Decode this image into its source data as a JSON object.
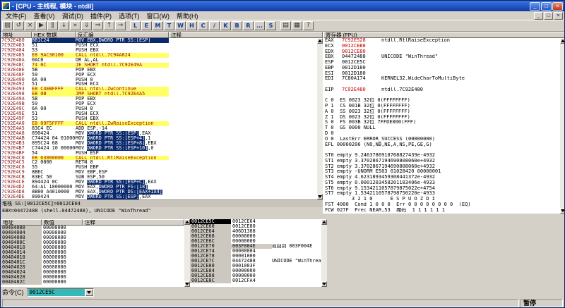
{
  "colors": {
    "title_blue": "#1b4fc4",
    "selection_navy": "#0b2a6e",
    "highlight_yellow": "#ffff66",
    "changed_register_red": "#c40000",
    "address_red": "#8a1616",
    "command_selection_teal": "#35b8b8"
  },
  "titlebar": {
    "title": "- [CPU - 主线程, 模块 - ntdll]"
  },
  "menu": {
    "items": [
      "文件(F)",
      "查看(V)",
      "调试(D)",
      "插件(P)",
      "选项(T)",
      "窗口(W)",
      "帮助(H)"
    ]
  },
  "toolbar": {
    "icon_buttons": [
      {
        "name": "open",
        "glyph": "▨"
      },
      {
        "name": "restart",
        "glyph": "↺"
      },
      {
        "name": "close-process",
        "glyph": "×"
      },
      {
        "name": "run",
        "glyph": "▶"
      },
      {
        "name": "pause",
        "glyph": "‖"
      },
      {
        "name": "step-into",
        "glyph": "↓"
      },
      {
        "name": "step-over",
        "glyph": "»"
      },
      {
        "name": "trace-into",
        "glyph": "⇓"
      },
      {
        "name": "trace-over",
        "glyph": "⇒"
      },
      {
        "name": "till-return",
        "glyph": "↑"
      },
      {
        "name": "goto",
        "glyph": "→"
      }
    ],
    "letter_buttons": [
      "L",
      "E",
      "M",
      "T",
      "W",
      "H",
      "C",
      "/",
      "K",
      "B",
      "R",
      "...",
      "S"
    ],
    "extra_buttons": [
      {
        "name": "appearance",
        "glyph": "▤"
      },
      {
        "name": "options",
        "glyph": "▦"
      },
      {
        "name": "help",
        "glyph": "?"
      }
    ]
  },
  "disasm": {
    "headers": [
      "地址",
      "HEX 数据",
      "反汇编",
      "注释"
    ],
    "rows": [
      {
        "addr": "7C92E480",
        "hex": "8B1C24",
        "segs": [
          [
            "MOV EBX,DWORD PTR SS:[ESP]",
            "p"
          ]
        ],
        "comment": "",
        "style": "sel"
      },
      {
        "addr": "7C92E483",
        "hex": "51",
        "segs": [
          [
            "PUSH ECX",
            "p"
          ]
        ],
        "comment": ""
      },
      {
        "addr": "7C92E484",
        "hex": "53",
        "segs": [
          [
            "PUSH EBX",
            "p"
          ]
        ],
        "comment": ""
      },
      {
        "addr": "7C92E485",
        "hex": "E8 9AC30100",
        "segs": [
          [
            "CALL ntdll.7C94A824",
            "p"
          ]
        ],
        "comment": "",
        "style": "flow"
      },
      {
        "addr": "7C92E48A",
        "hex": "0AC0",
        "segs": [
          [
            "OR AL,AL",
            "p"
          ]
        ],
        "comment": ""
      },
      {
        "addr": "7C92E48C",
        "hex": "74 0C",
        "segs": [
          [
            "JE SHORT ntdll.7C92E49A",
            "p"
          ]
        ],
        "comment": "",
        "style": "flow"
      },
      {
        "addr": "7C92E48E",
        "hex": "5B",
        "segs": [
          [
            "POP EBX",
            "p"
          ]
        ],
        "comment": ""
      },
      {
        "addr": "7C92E48F",
        "hex": "59",
        "segs": [
          [
            "POP ECX",
            "p"
          ]
        ],
        "comment": ""
      },
      {
        "addr": "7C92E490",
        "hex": "6A 00",
        "segs": [
          [
            "PUSH 0",
            "p"
          ]
        ],
        "comment": ""
      },
      {
        "addr": "7C92E492",
        "hex": "51",
        "segs": [
          [
            "PUSH ECX",
            "p"
          ]
        ],
        "comment": ""
      },
      {
        "addr": "7C92E493",
        "hex": "E8 C4EBFFFF",
        "segs": [
          [
            "CALL ntdll.ZwContinue",
            "p"
          ]
        ],
        "comment": "",
        "style": "flow"
      },
      {
        "addr": "7C92E498",
        "hex": "EB 0B",
        "segs": [
          [
            "JMP SHORT ntdll.7C92E4A5",
            "p"
          ]
        ],
        "comment": "",
        "style": "flow"
      },
      {
        "addr": "7C92E49A",
        "hex": "5B",
        "segs": [
          [
            "POP EBX",
            "p"
          ]
        ],
        "comment": ""
      },
      {
        "addr": "7C92E49B",
        "hex": "59",
        "segs": [
          [
            "POP ECX",
            "p"
          ]
        ],
        "comment": ""
      },
      {
        "addr": "7C92E49C",
        "hex": "6A 00",
        "segs": [
          [
            "PUSH 0",
            "p"
          ]
        ],
        "comment": ""
      },
      {
        "addr": "7C92E49E",
        "hex": "51",
        "segs": [
          [
            "PUSH ECX",
            "p"
          ]
        ],
        "comment": ""
      },
      {
        "addr": "7C92E49F",
        "hex": "53",
        "segs": [
          [
            "PUSH EBX",
            "p"
          ]
        ],
        "comment": ""
      },
      {
        "addr": "7C92E4A0",
        "hex": "E8 09F5FFFF",
        "segs": [
          [
            "CALL ntdll.ZwRaiseException",
            "p"
          ]
        ],
        "comment": "",
        "style": "flow"
      },
      {
        "addr": "7C92E4A5",
        "hex": "83C4 EC",
        "segs": [
          [
            "ADD ESP,-14",
            "p"
          ]
        ],
        "comment": ""
      },
      {
        "addr": "7C92E4A8",
        "hex": "890424",
        "segs": [
          [
            "MOV ",
            "p"
          ],
          [
            "DWORD PTR SS:[ESP]",
            "m"
          ],
          [
            ",EAX",
            "p"
          ]
        ],
        "comment": ""
      },
      {
        "addr": "7C92E4AB",
        "hex": "C74424 04 01000000",
        "segs": [
          [
            "MOV ",
            "p"
          ],
          [
            "DWORD PTR SS:[ESP+4]",
            "m"
          ],
          [
            ",1",
            "p"
          ]
        ],
        "comment": ""
      },
      {
        "addr": "7C92E4B3",
        "hex": "895C24 08",
        "segs": [
          [
            "MOV ",
            "p"
          ],
          [
            "DWORD PTR SS:[ESP+8]",
            "m"
          ],
          [
            ",EBX",
            "p"
          ]
        ],
        "comment": ""
      },
      {
        "addr": "7C92E4B7",
        "hex": "C74424 10 00000000",
        "segs": [
          [
            "MOV ",
            "p"
          ],
          [
            "DWORD PTR SS:[ESP+10]",
            "m"
          ],
          [
            ",0",
            "p"
          ]
        ],
        "comment": ""
      },
      {
        "addr": "7C92E4BF",
        "hex": "54",
        "segs": [
          [
            "PUSH ESP",
            "p"
          ]
        ],
        "comment": ""
      },
      {
        "addr": "7C92E4C0",
        "hex": "E8 63000000",
        "segs": [
          [
            "CALL ntdll.RtlRaiseException",
            "p"
          ]
        ],
        "comment": "",
        "style": "flow"
      },
      {
        "addr": "7C92E4C5",
        "hex": "C2 0800",
        "segs": [
          [
            "RETN 8",
            "p"
          ]
        ],
        "comment": ""
      },
      {
        "addr": "7C92E4C8",
        "hex": "55",
        "segs": [
          [
            "PUSH EBP",
            "p"
          ]
        ],
        "comment": ""
      },
      {
        "addr": "7C92E4C9",
        "hex": "8BEC",
        "segs": [
          [
            "MOV EBP,ESP",
            "p"
          ]
        ],
        "comment": ""
      },
      {
        "addr": "7C92E4CB",
        "hex": "83EC 50",
        "segs": [
          [
            "SUB ESP,50",
            "p"
          ]
        ],
        "comment": ""
      },
      {
        "addr": "7C92E4CE",
        "hex": "894424 0C",
        "segs": [
          [
            "MOV ",
            "p"
          ],
          [
            "DWORD PTR SS:[ESP+C]",
            "m"
          ],
          [
            ",EAX",
            "p"
          ]
        ],
        "comment": ""
      },
      {
        "addr": "7C92E4D2",
        "hex": "64:A1 18000000",
        "segs": [
          [
            "MOV EAX,",
            "p"
          ],
          [
            "DWORD PTR FS:[18]",
            "m"
          ]
        ],
        "comment": ""
      },
      {
        "addr": "7C92E4D8",
        "hex": "8B80 A4010000",
        "segs": [
          [
            "MOV EAX,",
            "p"
          ],
          [
            "DWORD PTR DS:[EAX+1A4]",
            "m"
          ]
        ],
        "comment": ""
      },
      {
        "addr": "7C92E4DE",
        "hex": "890424",
        "segs": [
          [
            "MOV ",
            "p"
          ],
          [
            "DWORD PTR SS:[ESP]",
            "m"
          ],
          [
            ",EAX",
            "p"
          ]
        ],
        "comment": ""
      }
    ]
  },
  "info_pane": {
    "lines": [
      "堆栈 SS:[0012CE5C]=0012CE64",
      "EBX=04472488 (shell.04472488), UNICODE \"WinThread\""
    ]
  },
  "registers": {
    "header": "寄存器 (FPU)",
    "gpr": [
      {
        "name": "EAX",
        "value": "7C92E528",
        "note": "ntdll.RtlRaiseException",
        "changed": true
      },
      {
        "name": "ECX",
        "value": "0012CEB8",
        "note": "",
        "changed": true
      },
      {
        "name": "EDX",
        "value": "0012CE80",
        "note": "",
        "changed": true
      },
      {
        "name": "EBX",
        "value": "04472488",
        "note": "UNICODE \"WinThread\"",
        "changed": false
      },
      {
        "name": "ESP",
        "value": "0012CE5C",
        "note": "",
        "changed": false
      },
      {
        "name": "EBP",
        "value": "0012D180",
        "note": "",
        "changed": false
      },
      {
        "name": "ESI",
        "value": "0012D180",
        "note": "",
        "changed": false
      },
      {
        "name": "EDI",
        "value": "7C80A174",
        "note": "KERNEL32.WideCharToMultiByte",
        "changed": false
      }
    ],
    "eip": {
      "name": "EIP",
      "value": "7C92E480",
      "note": "ntdll.7C92E480",
      "changed": true
    },
    "flag_lines": [
      "C 0  ES 0023 32位 0(FFFFFFFF)",
      "P 1  CS 001B 32位 0(FFFFFFFF)",
      "A 0  SS 0023 32位 0(FFFFFFFF)",
      "Z 1  DS 0023 32位 0(FFFFFFFF)",
      "S 0  FS 003B 32位 7FFDE000(FFF)",
      "T 0  GS 0000 NULL",
      "D 0",
      "O 0  LastErr ERROR_SUCCESS (00000000)"
    ],
    "efl_line": "EFL 00000206 (NO,NB,NE,A,NS,PE,GE,G)",
    "fpu_lines": [
      "ST0 empty 9.2463786918768827439e-4932",
      "ST1 empty 3.3702867194690808060e+4932",
      "ST2 empty 3.3702867194690808060e+4932",
      "ST3 empty -UNORM E503 01028420 00000001",
      "ST4 empty 4.6231893459308441372e-4932",
      "ST5 empty 0.0001203458201183406e-4933",
      "ST6 empty 9.1534211057879875022e+4754",
      "ST7 empty 1.5342110578798750220e-4933"
    ],
    "fpu_status_lines": [
      "         3 2 1 0      E S P U O Z D I",
      "FST 4000  Cond 1 0 0 0  Err 0 0 0 0 0 0 0 0  (EQ)",
      "FCW 027F  Prec NEAR,53  掩码  1 1 1 1 1 1"
    ]
  },
  "dump": {
    "headers": [
      "地址",
      "数值",
      "注释"
    ],
    "rows": [
      [
        "00404000",
        "00000000",
        ""
      ],
      [
        "00404004",
        "00000000",
        ""
      ],
      [
        "00404008",
        "00000000",
        ""
      ],
      [
        "0040400C",
        "00000000",
        ""
      ],
      [
        "00404010",
        "00000000",
        ""
      ],
      [
        "00404014",
        "00000000",
        ""
      ],
      [
        "00404018",
        "00000000",
        ""
      ],
      [
        "0040401C",
        "00000000",
        ""
      ],
      [
        "00404020",
        "00000000",
        ""
      ],
      [
        "00404024",
        "00000000",
        ""
      ],
      [
        "00404028",
        "00000000",
        ""
      ],
      [
        "0040402C",
        "00000000",
        ""
      ]
    ]
  },
  "stack": {
    "rows": [
      {
        "addr": "0012CE5C",
        "value": "0012CE64",
        "comment": "",
        "sel": true
      },
      {
        "addr": "0012CE60",
        "value": "0012CE80",
        "comment": ""
      },
      {
        "addr": "0012CE64",
        "value": "406D1388",
        "comment": ""
      },
      {
        "addr": "0012CE68",
        "value": "00000000",
        "comment": ""
      },
      {
        "addr": "0012CE6C",
        "value": "00000000",
        "comment": ""
      },
      {
        "addr": "0012CE70",
        "value": "003F004E",
        "comment": "返回到 003F004E",
        "code": true
      },
      {
        "addr": "0012CE74",
        "value": "00000004",
        "comment": ""
      },
      {
        "addr": "0012CE78",
        "value": "00001000",
        "comment": ""
      },
      {
        "addr": "0012CE7C",
        "value": "04472488",
        "comment": "UNICODE \"WinThread\""
      },
      {
        "addr": "0012CE80",
        "value": "0001003F",
        "comment": ""
      },
      {
        "addr": "0012CE84",
        "value": "00000000",
        "comment": ""
      },
      {
        "addr": "0012CE88",
        "value": "00000000",
        "comment": ""
      },
      {
        "addr": "0012CE8C",
        "value": "0012CFA4",
        "comment": ""
      }
    ]
  },
  "command": {
    "label": "命令(C)",
    "value": "0012CE5C"
  },
  "status": {
    "left": "",
    "right": "暂停"
  }
}
